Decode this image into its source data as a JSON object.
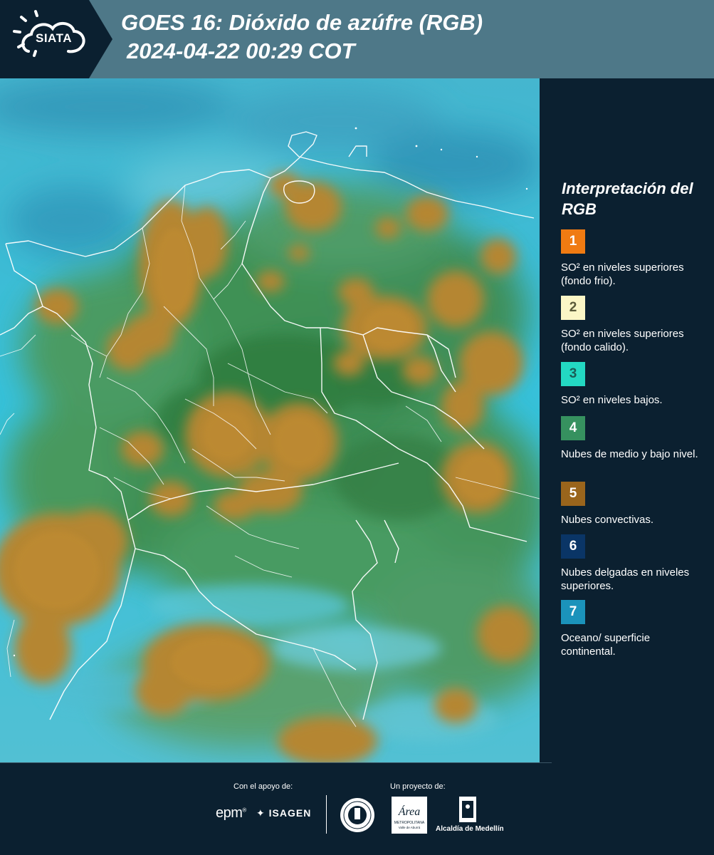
{
  "header": {
    "logo_text": "SIATA",
    "title_line1": "GOES 16: Dióxido de azúfre (RGB)",
    "title_line2": "2024-04-22 00:29 COT"
  },
  "legend": {
    "title": "Interpretación del RGB",
    "items": [
      {
        "number": "1",
        "color": "#f07b12",
        "text_color": "#ffffff",
        "description": "SO² en niveles superiores (fondo frio)."
      },
      {
        "number": "2",
        "color": "#fbf6c6",
        "text_color": "#5a5a3a",
        "description": "SO² en niveles superiores (fondo calido)."
      },
      {
        "number": "3",
        "color": "#23d8c2",
        "text_color": "#1b5b55",
        "description": "SO² en niveles bajos."
      },
      {
        "number": "4",
        "color": "#36915f",
        "text_color": "#ffffff",
        "description": "Nubes de medio y bajo nivel."
      },
      {
        "number": "5",
        "color": "#9a651c",
        "text_color": "#ffffff",
        "description": "Nubes convectivas."
      },
      {
        "number": "6",
        "color": "#0a3566",
        "text_color": "#ffffff",
        "description": "Nubes delgadas en niveles superiores."
      },
      {
        "number": "7",
        "color": "#1b93bb",
        "text_color": "#ffffff",
        "description": "Oceano/ superficie continental."
      }
    ]
  },
  "footer": {
    "support_label": "Con el apoyo de:",
    "project_label": "Un proyecto de:",
    "epm_text": "epm",
    "isagen_text": "ISAGEN",
    "alcaldia_text": "Alcaldía de Medellín"
  },
  "colors": {
    "header_bg": "#4e7888",
    "panel_bg": "#0b2030",
    "ocean_cyan": "#36c3dc",
    "convective_orange": "#b58632",
    "mid_low_green": "#3d8a52"
  }
}
